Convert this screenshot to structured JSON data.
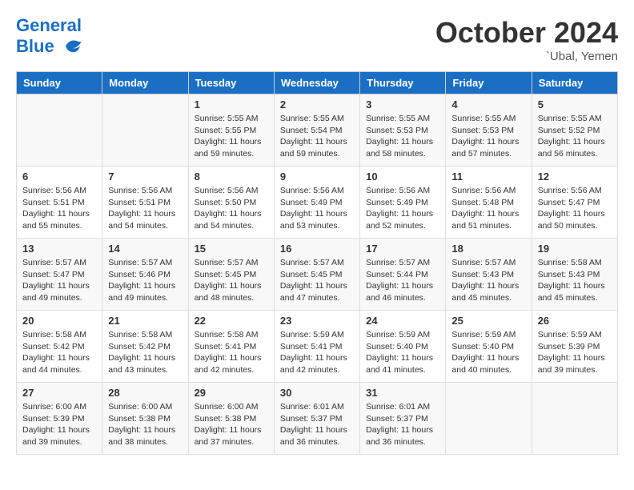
{
  "header": {
    "logo_line1": "General",
    "logo_line2": "Blue",
    "month_title": "October 2024",
    "location": "`Ubal, Yemen"
  },
  "days_of_week": [
    "Sunday",
    "Monday",
    "Tuesday",
    "Wednesday",
    "Thursday",
    "Friday",
    "Saturday"
  ],
  "weeks": [
    [
      {
        "day": "",
        "info": ""
      },
      {
        "day": "",
        "info": ""
      },
      {
        "day": "1",
        "info": "Sunrise: 5:55 AM\nSunset: 5:55 PM\nDaylight: 11 hours and 59 minutes."
      },
      {
        "day": "2",
        "info": "Sunrise: 5:55 AM\nSunset: 5:54 PM\nDaylight: 11 hours and 59 minutes."
      },
      {
        "day": "3",
        "info": "Sunrise: 5:55 AM\nSunset: 5:53 PM\nDaylight: 11 hours and 58 minutes."
      },
      {
        "day": "4",
        "info": "Sunrise: 5:55 AM\nSunset: 5:53 PM\nDaylight: 11 hours and 57 minutes."
      },
      {
        "day": "5",
        "info": "Sunrise: 5:55 AM\nSunset: 5:52 PM\nDaylight: 11 hours and 56 minutes."
      }
    ],
    [
      {
        "day": "6",
        "info": "Sunrise: 5:56 AM\nSunset: 5:51 PM\nDaylight: 11 hours and 55 minutes."
      },
      {
        "day": "7",
        "info": "Sunrise: 5:56 AM\nSunset: 5:51 PM\nDaylight: 11 hours and 54 minutes."
      },
      {
        "day": "8",
        "info": "Sunrise: 5:56 AM\nSunset: 5:50 PM\nDaylight: 11 hours and 54 minutes."
      },
      {
        "day": "9",
        "info": "Sunrise: 5:56 AM\nSunset: 5:49 PM\nDaylight: 11 hours and 53 minutes."
      },
      {
        "day": "10",
        "info": "Sunrise: 5:56 AM\nSunset: 5:49 PM\nDaylight: 11 hours and 52 minutes."
      },
      {
        "day": "11",
        "info": "Sunrise: 5:56 AM\nSunset: 5:48 PM\nDaylight: 11 hours and 51 minutes."
      },
      {
        "day": "12",
        "info": "Sunrise: 5:56 AM\nSunset: 5:47 PM\nDaylight: 11 hours and 50 minutes."
      }
    ],
    [
      {
        "day": "13",
        "info": "Sunrise: 5:57 AM\nSunset: 5:47 PM\nDaylight: 11 hours and 49 minutes."
      },
      {
        "day": "14",
        "info": "Sunrise: 5:57 AM\nSunset: 5:46 PM\nDaylight: 11 hours and 49 minutes."
      },
      {
        "day": "15",
        "info": "Sunrise: 5:57 AM\nSunset: 5:45 PM\nDaylight: 11 hours and 48 minutes."
      },
      {
        "day": "16",
        "info": "Sunrise: 5:57 AM\nSunset: 5:45 PM\nDaylight: 11 hours and 47 minutes."
      },
      {
        "day": "17",
        "info": "Sunrise: 5:57 AM\nSunset: 5:44 PM\nDaylight: 11 hours and 46 minutes."
      },
      {
        "day": "18",
        "info": "Sunrise: 5:57 AM\nSunset: 5:43 PM\nDaylight: 11 hours and 45 minutes."
      },
      {
        "day": "19",
        "info": "Sunrise: 5:58 AM\nSunset: 5:43 PM\nDaylight: 11 hours and 45 minutes."
      }
    ],
    [
      {
        "day": "20",
        "info": "Sunrise: 5:58 AM\nSunset: 5:42 PM\nDaylight: 11 hours and 44 minutes."
      },
      {
        "day": "21",
        "info": "Sunrise: 5:58 AM\nSunset: 5:42 PM\nDaylight: 11 hours and 43 minutes."
      },
      {
        "day": "22",
        "info": "Sunrise: 5:58 AM\nSunset: 5:41 PM\nDaylight: 11 hours and 42 minutes."
      },
      {
        "day": "23",
        "info": "Sunrise: 5:59 AM\nSunset: 5:41 PM\nDaylight: 11 hours and 42 minutes."
      },
      {
        "day": "24",
        "info": "Sunrise: 5:59 AM\nSunset: 5:40 PM\nDaylight: 11 hours and 41 minutes."
      },
      {
        "day": "25",
        "info": "Sunrise: 5:59 AM\nSunset: 5:40 PM\nDaylight: 11 hours and 40 minutes."
      },
      {
        "day": "26",
        "info": "Sunrise: 5:59 AM\nSunset: 5:39 PM\nDaylight: 11 hours and 39 minutes."
      }
    ],
    [
      {
        "day": "27",
        "info": "Sunrise: 6:00 AM\nSunset: 5:39 PM\nDaylight: 11 hours and 39 minutes."
      },
      {
        "day": "28",
        "info": "Sunrise: 6:00 AM\nSunset: 5:38 PM\nDaylight: 11 hours and 38 minutes."
      },
      {
        "day": "29",
        "info": "Sunrise: 6:00 AM\nSunset: 5:38 PM\nDaylight: 11 hours and 37 minutes."
      },
      {
        "day": "30",
        "info": "Sunrise: 6:01 AM\nSunset: 5:37 PM\nDaylight: 11 hours and 36 minutes."
      },
      {
        "day": "31",
        "info": "Sunrise: 6:01 AM\nSunset: 5:37 PM\nDaylight: 11 hours and 36 minutes."
      },
      {
        "day": "",
        "info": ""
      },
      {
        "day": "",
        "info": ""
      }
    ]
  ]
}
